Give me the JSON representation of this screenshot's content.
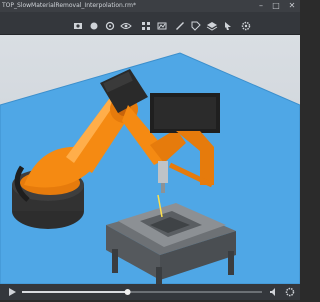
{
  "window": {
    "title": "TOP_SlowMaterialRemoval_Interpolation.rm*",
    "minimize": "–",
    "maximize": "□",
    "close": "✕"
  },
  "toolbar": {
    "icons": [
      "camera-icon",
      "record-icon",
      "view-icon",
      "eye-icon",
      "grid-icon",
      "scene-icon",
      "measure-icon",
      "tag-icon",
      "layers-icon",
      "cursor-icon",
      "settings-icon"
    ]
  },
  "playback": {
    "progress": 0.44,
    "controls": [
      "play",
      "volume",
      "settings"
    ]
  },
  "colors": {
    "robot": "#f58a12",
    "floor": "#4fa7e6",
    "viewport_bg": "#d2d8de"
  }
}
